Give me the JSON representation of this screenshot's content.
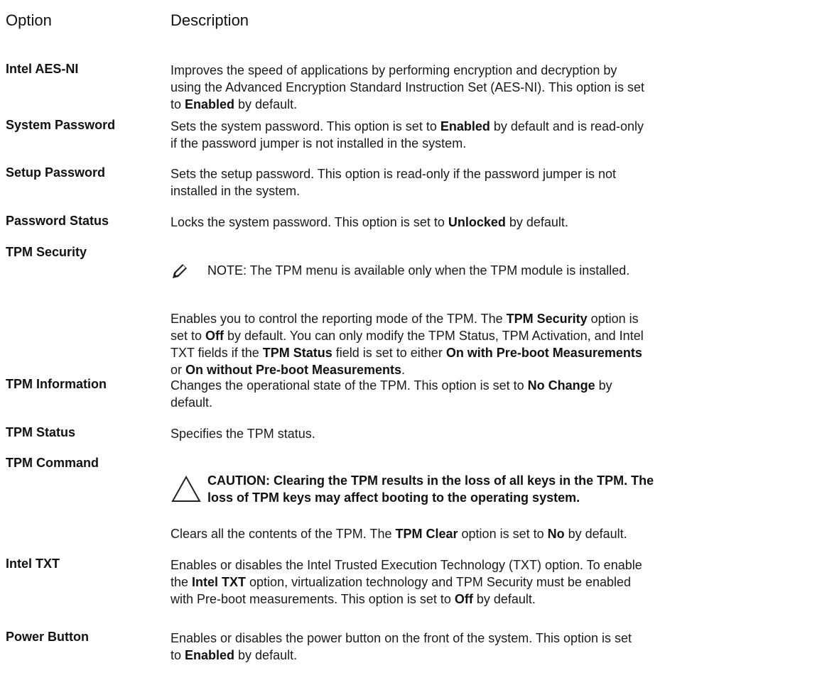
{
  "header": {
    "option": "Option",
    "description": "Description"
  },
  "rows": {
    "aesni": {
      "option": "Intel AES-NI",
      "d1": "Improves the speed of applications by performing encryption and decryption by",
      "d2": "using the Advanced Encryption Standard Instruction Set (AES-NI). This option is set",
      "d3a": "to ",
      "d3b": "Enabled",
      "d3c": " by default."
    },
    "syspw": {
      "option": "System Password",
      "d1a": "Sets the system password. This option is set to ",
      "d1b": "Enabled",
      "d1c": " by default and is read-only",
      "d2": "if the password jumper is not installed in the system."
    },
    "setuppw": {
      "option": "Setup Password",
      "d1": "Sets the setup password. This option is read-only if the password jumper is not",
      "d2": "installed in the system."
    },
    "pwstatus": {
      "option": "Password Status",
      "d1a": "Locks the system password. This option is set to ",
      "d1b": "Unlocked",
      "d1c": " by default."
    },
    "tpmsec": {
      "option": "TPM Security",
      "note_label": "NOTE:",
      "note_text": " The TPM menu is available only when the TPM module is installed.",
      "d1a": "Enables you to control the reporting mode of the TPM. The ",
      "d1b": "TPM Security",
      "d1c": " option is",
      "d2a": "set to ",
      "d2b": "Off",
      "d2c": " by default. You can only modify the TPM Status, TPM Activation, and Intel",
      "d3a": "TXT fields if the ",
      "d3b": "TPM Status",
      "d3c": " field is set to either ",
      "d3d": "On with Pre-boot Measurements",
      "d4a": "or ",
      "d4b": "On without Pre-boot Measurements",
      "d4c": "."
    },
    "tpminfo": {
      "option": "TPM Information",
      "d1a": "Changes the operational state of the TPM. This option is set to ",
      "d1b": "No Change",
      "d1c": " by",
      "d2": "default."
    },
    "tpmstatus": {
      "option": "TPM Status",
      "d1": "Specifies the TPM status."
    },
    "tpmcmd": {
      "option": "TPM Command",
      "caution1": "CAUTION: Clearing the TPM results in the loss of all keys in the TPM. The",
      "caution2": "loss of TPM keys may affect booting to the operating system.",
      "d1a": "Clears all the contents of the TPM. The ",
      "d1b": "TPM Clear",
      "d1c": " option is set to ",
      "d1d": "No",
      "d1e": " by default."
    },
    "txt": {
      "option": "Intel TXT",
      "d1": "Enables or disables the Intel Trusted Execution Technology (TXT) option. To enable",
      "d2a": "the ",
      "d2b": "Intel TXT",
      "d2c": " option, virtualization technology and TPM Security must be enabled",
      "d3a": "with Pre-boot measurements. This option is set to ",
      "d3b": "Off",
      "d3c": " by default."
    },
    "power": {
      "option": "Power Button",
      "d1": "Enables or disables the power button on the front of the system. This option is set",
      "d2a": "to ",
      "d2b": "Enabled",
      "d2c": " by default."
    }
  },
  "icons": {
    "note": "pencil-note-icon",
    "caution": "caution-triangle-icon"
  }
}
